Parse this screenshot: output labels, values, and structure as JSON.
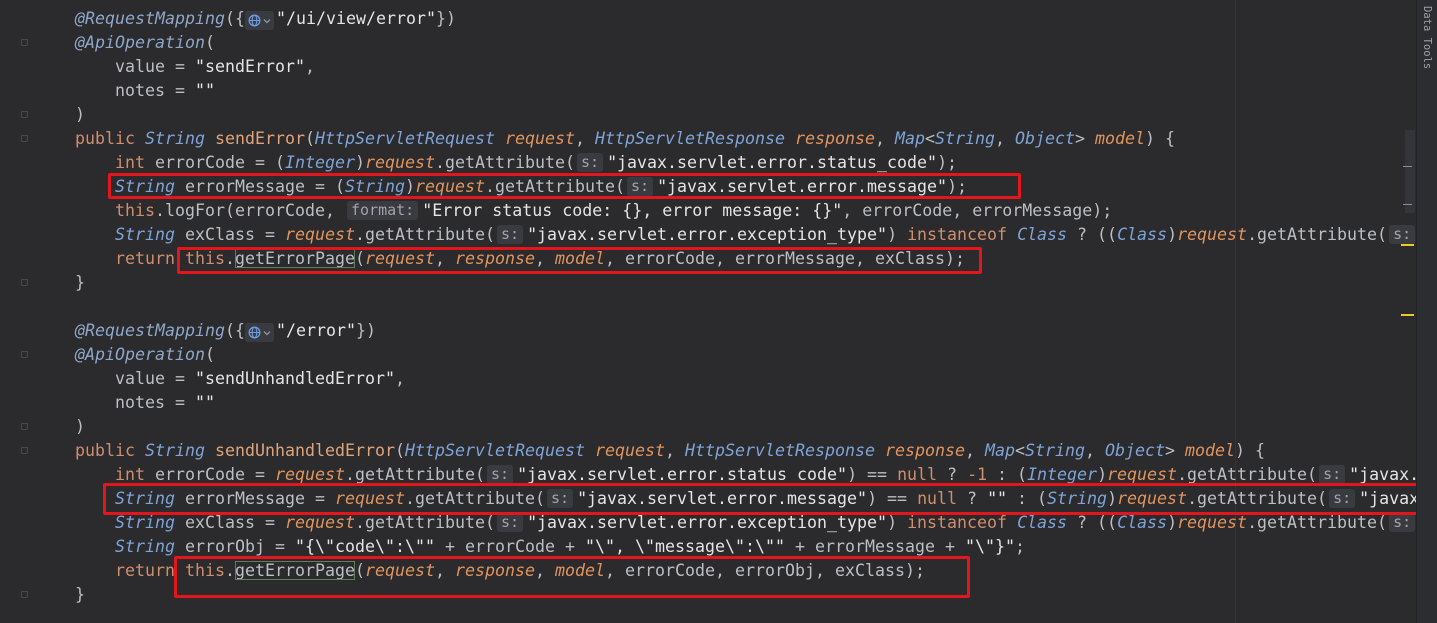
{
  "colors": {
    "highlight_box": "#e3161e",
    "editor_background": "#2b2b2e"
  },
  "side_panel": {
    "label": "Data Tools"
  },
  "editor": {
    "lines": [
      {
        "tokens": [
          {
            "k": "an",
            "t": "@RequestMapping"
          },
          {
            "k": "p",
            "t": "({"
          },
          {
            "k": "gl",
            "icon": "globe-icon"
          },
          {
            "k": "st",
            "t": "\"/ui/view/error\""
          },
          {
            "k": "p",
            "t": "})"
          }
        ]
      },
      {
        "tokens": [
          {
            "k": "an",
            "t": "@ApiOperation"
          },
          {
            "k": "p",
            "t": "("
          }
        ]
      },
      {
        "tokens": [
          {
            "k": "p",
            "t": "    value = "
          },
          {
            "k": "st",
            "t": "\"sendError\""
          },
          {
            "k": "p",
            "t": ","
          }
        ]
      },
      {
        "tokens": [
          {
            "k": "p",
            "t": "    notes = "
          },
          {
            "k": "st",
            "t": "\"\""
          }
        ]
      },
      {
        "tokens": [
          {
            "k": "p",
            "t": ")"
          }
        ]
      },
      {
        "tokens": [
          {
            "k": "kw",
            "t": "public"
          },
          {
            "k": "p",
            "t": " "
          },
          {
            "k": "ty",
            "t": "String"
          },
          {
            "k": "p",
            "t": " "
          },
          {
            "k": "de",
            "t": "sendError"
          },
          {
            "k": "p",
            "t": "("
          },
          {
            "k": "ty",
            "t": "HttpServletRequest"
          },
          {
            "k": "p",
            "t": " "
          },
          {
            "k": "pa",
            "t": "request"
          },
          {
            "k": "p",
            "t": ", "
          },
          {
            "k": "ty",
            "t": "HttpServletResponse"
          },
          {
            "k": "p",
            "t": " "
          },
          {
            "k": "pa",
            "t": "response"
          },
          {
            "k": "p",
            "t": ", "
          },
          {
            "k": "ty",
            "t": "Map"
          },
          {
            "k": "p",
            "t": "<"
          },
          {
            "k": "ty",
            "t": "String"
          },
          {
            "k": "p",
            "t": ", "
          },
          {
            "k": "ty",
            "t": "Object"
          },
          {
            "k": "p",
            "t": "> "
          },
          {
            "k": "pa",
            "t": "model"
          },
          {
            "k": "p",
            "t": ") {"
          }
        ]
      },
      {
        "tokens": [
          {
            "k": "p",
            "t": "    "
          },
          {
            "k": "kw",
            "t": "int"
          },
          {
            "k": "p",
            "t": " errorCode = ("
          },
          {
            "k": "ty",
            "t": "Integer"
          },
          {
            "k": "p",
            "t": ")"
          },
          {
            "k": "pa",
            "t": "request"
          },
          {
            "k": "p",
            "t": ".getAttribute("
          },
          {
            "k": "ih",
            "t": "s:"
          },
          {
            "k": "st",
            "t": "\"javax.servlet.error.status_code\""
          },
          {
            "k": "p",
            "t": ");"
          }
        ]
      },
      {
        "tokens": [
          {
            "k": "p",
            "t": "    "
          },
          {
            "k": "ty",
            "t": "String"
          },
          {
            "k": "p",
            "t": " errorMessage = ("
          },
          {
            "k": "ty",
            "t": "String"
          },
          {
            "k": "p",
            "t": ")"
          },
          {
            "k": "pa",
            "t": "request"
          },
          {
            "k": "p",
            "t": ".getAttribute("
          },
          {
            "k": "ih",
            "t": "s:"
          },
          {
            "k": "st",
            "t": "\"javax.servlet.error.message\""
          },
          {
            "k": "p",
            "t": ");"
          }
        ]
      },
      {
        "tokens": [
          {
            "k": "p",
            "t": "    "
          },
          {
            "k": "kw",
            "t": "this"
          },
          {
            "k": "p",
            "t": ".logFor(errorCode, "
          },
          {
            "k": "ih",
            "t": "format:"
          },
          {
            "k": "st",
            "t": "\"Error status code: {}, error message: {}\""
          },
          {
            "k": "p",
            "t": ", errorCode, errorMessage);"
          }
        ]
      },
      {
        "tokens": [
          {
            "k": "p",
            "t": "    "
          },
          {
            "k": "ty",
            "t": "String"
          },
          {
            "k": "p",
            "t": " exClass = "
          },
          {
            "k": "pa",
            "t": "request"
          },
          {
            "k": "p",
            "t": ".getAttribute("
          },
          {
            "k": "ih",
            "t": "s:"
          },
          {
            "k": "st",
            "t": "\"javax.servlet.error.exception_type\""
          },
          {
            "k": "p",
            "t": ") "
          },
          {
            "k": "kw",
            "t": "instanceof"
          },
          {
            "k": "p",
            "t": " "
          },
          {
            "k": "ty",
            "t": "Class"
          },
          {
            "k": "p",
            "t": " ? (("
          },
          {
            "k": "ty",
            "t": "Class"
          },
          {
            "k": "p",
            "t": ")"
          },
          {
            "k": "pa",
            "t": "request"
          },
          {
            "k": "p",
            "t": ".getAttribute("
          },
          {
            "k": "ih",
            "t": "s:"
          }
        ]
      },
      {
        "tokens": [
          {
            "k": "p",
            "t": "    "
          },
          {
            "k": "kw",
            "t": "return"
          },
          {
            "k": "p",
            "t": " "
          },
          {
            "k": "kw",
            "t": "this"
          },
          {
            "k": "p",
            "t": "."
          },
          {
            "k": "mh",
            "t": "getErrorPage"
          },
          {
            "k": "p",
            "t": "("
          },
          {
            "k": "pa",
            "t": "request"
          },
          {
            "k": "p",
            "t": ", "
          },
          {
            "k": "pa",
            "t": "response"
          },
          {
            "k": "p",
            "t": ", "
          },
          {
            "k": "pa",
            "t": "model"
          },
          {
            "k": "p",
            "t": ", errorCode, errorMessage, exClass);"
          }
        ]
      },
      {
        "tokens": [
          {
            "k": "p",
            "t": "}"
          }
        ]
      },
      {
        "tokens": []
      },
      {
        "tokens": [
          {
            "k": "an",
            "t": "@RequestMapping"
          },
          {
            "k": "p",
            "t": "({"
          },
          {
            "k": "gl",
            "icon": "globe-icon"
          },
          {
            "k": "st",
            "t": "\"/error\""
          },
          {
            "k": "p",
            "t": "})"
          }
        ]
      },
      {
        "tokens": [
          {
            "k": "an",
            "t": "@ApiOperation"
          },
          {
            "k": "p",
            "t": "("
          }
        ]
      },
      {
        "tokens": [
          {
            "k": "p",
            "t": "    value = "
          },
          {
            "k": "st",
            "t": "\"sendUnhandledError\""
          },
          {
            "k": "p",
            "t": ","
          }
        ]
      },
      {
        "tokens": [
          {
            "k": "p",
            "t": "    notes = "
          },
          {
            "k": "st",
            "t": "\"\""
          }
        ]
      },
      {
        "tokens": [
          {
            "k": "p",
            "t": ")"
          }
        ]
      },
      {
        "tokens": [
          {
            "k": "kw",
            "t": "public"
          },
          {
            "k": "p",
            "t": " "
          },
          {
            "k": "ty",
            "t": "String"
          },
          {
            "k": "p",
            "t": " "
          },
          {
            "k": "de",
            "t": "sendUnhandledError"
          },
          {
            "k": "p",
            "t": "("
          },
          {
            "k": "ty",
            "t": "HttpServletRequest"
          },
          {
            "k": "p",
            "t": " "
          },
          {
            "k": "pa",
            "t": "request"
          },
          {
            "k": "p",
            "t": ", "
          },
          {
            "k": "ty",
            "t": "HttpServletResponse"
          },
          {
            "k": "p",
            "t": " "
          },
          {
            "k": "pa",
            "t": "response"
          },
          {
            "k": "p",
            "t": ", "
          },
          {
            "k": "ty",
            "t": "Map"
          },
          {
            "k": "p",
            "t": "<"
          },
          {
            "k": "ty",
            "t": "String"
          },
          {
            "k": "p",
            "t": ", "
          },
          {
            "k": "ty",
            "t": "Object"
          },
          {
            "k": "p",
            "t": "> "
          },
          {
            "k": "pa",
            "t": "model"
          },
          {
            "k": "p",
            "t": ") {"
          }
        ]
      },
      {
        "tokens": [
          {
            "k": "p",
            "t": "    "
          },
          {
            "k": "kw",
            "t": "int"
          },
          {
            "k": "p",
            "t": " errorCode = "
          },
          {
            "k": "pa",
            "t": "request"
          },
          {
            "k": "p",
            "t": ".getAttribute("
          },
          {
            "k": "ih",
            "t": "s:"
          },
          {
            "k": "st",
            "t": "\"javax.servlet.error.status_code\""
          },
          {
            "k": "p",
            "t": ") == "
          },
          {
            "k": "kw",
            "t": "null"
          },
          {
            "k": "p",
            "t": " ? "
          },
          {
            "k": "nu",
            "t": "-1"
          },
          {
            "k": "p",
            "t": " : ("
          },
          {
            "k": "ty",
            "t": "Integer"
          },
          {
            "k": "p",
            "t": ")"
          },
          {
            "k": "pa",
            "t": "request"
          },
          {
            "k": "p",
            "t": ".getAttribute("
          },
          {
            "k": "ih",
            "t": "s:"
          },
          {
            "k": "st",
            "t": "\"javax."
          }
        ]
      },
      {
        "tokens": [
          {
            "k": "p",
            "t": "    "
          },
          {
            "k": "ty",
            "t": "String"
          },
          {
            "k": "p",
            "t": " errorMessage = "
          },
          {
            "k": "pa",
            "t": "request"
          },
          {
            "k": "p",
            "t": ".getAttribute("
          },
          {
            "k": "ih",
            "t": "s:"
          },
          {
            "k": "st",
            "t": "\"javax.servlet.error.message\""
          },
          {
            "k": "p",
            "t": ") == "
          },
          {
            "k": "kw",
            "t": "null"
          },
          {
            "k": "p",
            "t": " ? "
          },
          {
            "k": "st",
            "t": "\"\""
          },
          {
            "k": "p",
            "t": " : ("
          },
          {
            "k": "ty",
            "t": "String"
          },
          {
            "k": "p",
            "t": ")"
          },
          {
            "k": "pa",
            "t": "request"
          },
          {
            "k": "p",
            "t": ".getAttribute("
          },
          {
            "k": "ih",
            "t": "s:"
          },
          {
            "k": "st",
            "t": "\"javax"
          }
        ]
      },
      {
        "tokens": [
          {
            "k": "p",
            "t": "    "
          },
          {
            "k": "ty",
            "t": "String"
          },
          {
            "k": "p",
            "t": " exClass = "
          },
          {
            "k": "pa",
            "t": "request"
          },
          {
            "k": "p",
            "t": ".getAttribute("
          },
          {
            "k": "ih",
            "t": "s:"
          },
          {
            "k": "st",
            "t": "\"javax.servlet.error.exception_type\""
          },
          {
            "k": "p",
            "t": ") "
          },
          {
            "k": "kw",
            "t": "instanceof"
          },
          {
            "k": "p",
            "t": " "
          },
          {
            "k": "ty",
            "t": "Class"
          },
          {
            "k": "p",
            "t": " ? (("
          },
          {
            "k": "ty",
            "t": "Class"
          },
          {
            "k": "p",
            "t": ")"
          },
          {
            "k": "pa",
            "t": "request"
          },
          {
            "k": "p",
            "t": ".getAttribute("
          },
          {
            "k": "ih",
            "t": "s:"
          }
        ]
      },
      {
        "tokens": [
          {
            "k": "p",
            "t": "    "
          },
          {
            "k": "ty",
            "t": "String"
          },
          {
            "k": "p",
            "t": " errorObj = "
          },
          {
            "k": "st",
            "t": "\"{\\\"code\\\":\\\"\""
          },
          {
            "k": "p",
            "t": " + errorCode + "
          },
          {
            "k": "st",
            "t": "\"\\\", \\\"message\\\":\\\"\""
          },
          {
            "k": "p",
            "t": " + errorMessage + "
          },
          {
            "k": "st",
            "t": "\"\\\"}\""
          },
          {
            "k": "p",
            "t": ";"
          }
        ]
      },
      {
        "tokens": [
          {
            "k": "p",
            "t": "    "
          },
          {
            "k": "kw",
            "t": "return"
          },
          {
            "k": "p",
            "t": " "
          },
          {
            "k": "kw",
            "t": "this"
          },
          {
            "k": "p",
            "t": "."
          },
          {
            "k": "mh",
            "t": "getErrorPage"
          },
          {
            "k": "p",
            "t": "("
          },
          {
            "k": "pa",
            "t": "request"
          },
          {
            "k": "p",
            "t": ", "
          },
          {
            "k": "pa",
            "t": "response"
          },
          {
            "k": "p",
            "t": ", "
          },
          {
            "k": "pa",
            "t": "model"
          },
          {
            "k": "p",
            "t": ", errorCode, errorObj, exClass);"
          }
        ]
      },
      {
        "tokens": [
          {
            "k": "p",
            "t": "}"
          }
        ]
      }
    ]
  }
}
